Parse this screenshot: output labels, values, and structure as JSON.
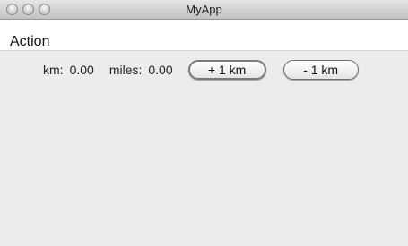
{
  "window": {
    "title": "MyApp"
  },
  "menu": {
    "items": [
      {
        "label": "Action"
      }
    ]
  },
  "converter": {
    "km_label": "km:",
    "km_value": "0.00",
    "miles_label": "miles:",
    "miles_value": "0.00",
    "add_button_label": "+ 1 km",
    "subtract_button_label": "- 1 km"
  }
}
